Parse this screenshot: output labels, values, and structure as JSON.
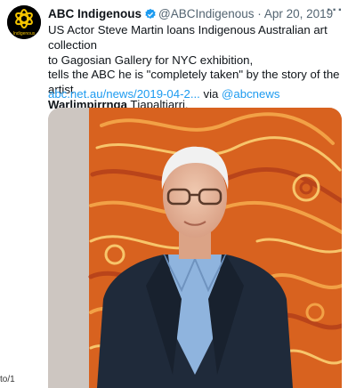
{
  "tweet": {
    "display_name": "ABC Indigenous",
    "handle": "@ABCIndigenous",
    "separator": "·",
    "date": "Apr 20, 2019",
    "more_label": "···",
    "avatar_text": "Indigenous",
    "text": {
      "line1": "US Actor Steve Martin loans Indigenous Australian art collection",
      "line2": "to Gagosian Gallery for NYC exhibition,",
      "line3": "tells the ABC he is \"completely taken\" by the story of the artist",
      "artist_bold": "Warlimpirrnga",
      "artist_rest": " Tjapaltjarri."
    },
    "link_text": "abc.net.au/news/2019-04-2...",
    "via_text": " via ",
    "via_handle": "@abcnews",
    "edge_text": "to/1"
  },
  "colors": {
    "link": "#1d9bf0",
    "verified": "#1d9bf0",
    "muted": "#536471",
    "art_orange": "#e2742a"
  },
  "icons": [
    "abc-logo-icon",
    "verified-badge-icon",
    "more-options-icon"
  ]
}
